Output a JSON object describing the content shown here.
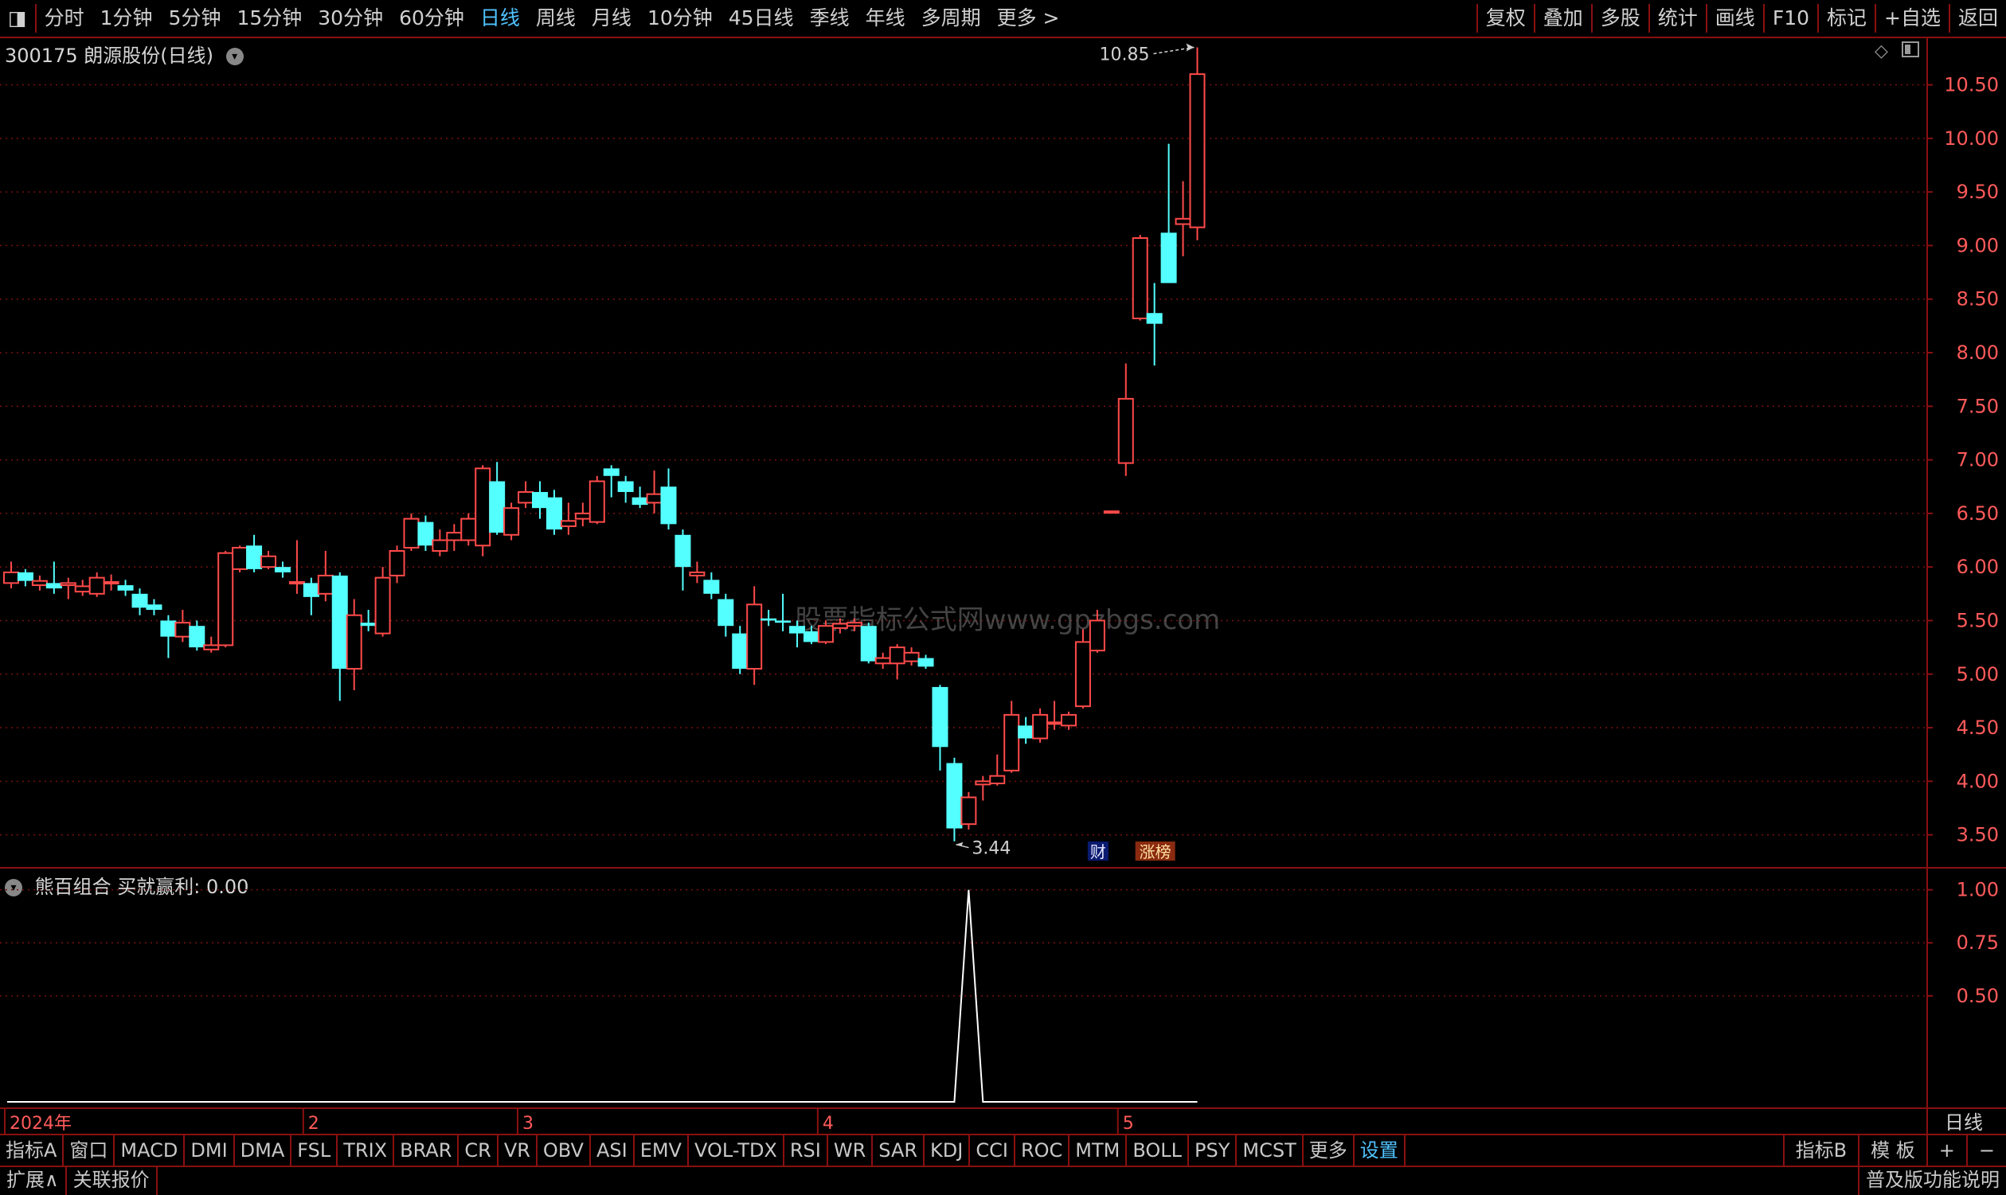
{
  "toolbar": {
    "periods": [
      "分时",
      "1分钟",
      "5分钟",
      "15分钟",
      "30分钟",
      "60分钟",
      "日线",
      "周线",
      "月线",
      "10分钟",
      "45日线",
      "季线",
      "年线",
      "多周期",
      "更多 >"
    ],
    "active_period": "日线",
    "right": [
      "复权",
      "叠加",
      "多股",
      "统计",
      "画线",
      "F10",
      "标记",
      "+自选",
      "返回"
    ]
  },
  "stock": {
    "title": "300175 朗源股份(日线)"
  },
  "indicator": {
    "title": "熊百组合  买就赢利: 0.00"
  },
  "watermark": "股票指标公式网www.gpzbgs.com",
  "badges": {
    "cai": "财",
    "zhang": "涨榜"
  },
  "main_axis": {
    "ticks": [
      "10.50",
      "10.00",
      "9.50",
      "9.00",
      "8.50",
      "8.00",
      "7.50",
      "7.00",
      "6.50",
      "6.00",
      "5.50",
      "5.00",
      "4.50",
      "4.00",
      "3.50"
    ]
  },
  "ind_axis": {
    "ticks": [
      "1.00",
      "0.75",
      "0.50"
    ]
  },
  "date_axis": {
    "labels": [
      "2024年",
      "2",
      "3",
      "4",
      "5"
    ],
    "corner": "日线"
  },
  "bottom_tabs": [
    "指标A",
    "窗口",
    "MACD",
    "DMI",
    "DMA",
    "FSL",
    "TRIX",
    "BRAR",
    "CR",
    "VR",
    "OBV",
    "ASI",
    "EMV",
    "VOL-TDX",
    "RSI",
    "WR",
    "SAR",
    "KDJ",
    "CCI",
    "ROC",
    "MTM",
    "BOLL",
    "PSY",
    "MCST",
    "更多",
    "设置"
  ],
  "bottom_right": [
    "指标B",
    "模 板",
    "+",
    "−"
  ],
  "status_left": [
    "扩展∧",
    "关联报价"
  ],
  "status_right": "普及版功能说明",
  "colors": {
    "up": "#ff4a4a",
    "down": "#54ffff",
    "frame": "#8a1010",
    "grid": "#7a1010",
    "axis_text": "#ff5a5a",
    "active": "#4fc3ff"
  },
  "chart_data": [
    {
      "type": "candlestick",
      "x_label_marks": [
        "2024年",
        "2",
        "3",
        "4",
        "5"
      ],
      "ylim": [
        3.2,
        10.95
      ],
      "max_label": "10.85",
      "min_label": "3.44",
      "candles": [
        [
          5.85,
          5.95,
          6.05,
          5.8
        ],
        [
          5.95,
          5.87,
          5.98,
          5.82
        ],
        [
          5.83,
          5.87,
          5.92,
          5.78
        ],
        [
          5.85,
          5.8,
          6.05,
          5.75
        ],
        [
          5.83,
          5.85,
          5.9,
          5.7
        ],
        [
          5.77,
          5.82,
          5.88,
          5.73
        ],
        [
          5.75,
          5.9,
          5.95,
          5.72
        ],
        [
          5.85,
          5.86,
          5.93,
          5.78
        ],
        [
          5.83,
          5.78,
          5.88,
          5.73
        ],
        [
          5.75,
          5.62,
          5.8,
          5.55
        ],
        [
          5.65,
          5.6,
          5.7,
          5.55
        ],
        [
          5.5,
          5.35,
          5.55,
          5.15
        ],
        [
          5.35,
          5.48,
          5.6,
          5.3
        ],
        [
          5.45,
          5.25,
          5.5,
          5.22
        ],
        [
          5.23,
          5.27,
          5.35,
          5.2
        ],
        [
          5.27,
          6.13,
          6.15,
          5.25
        ],
        [
          5.98,
          6.18,
          6.2,
          5.95
        ],
        [
          6.2,
          5.98,
          6.3,
          5.95
        ],
        [
          6.0,
          6.1,
          6.15,
          5.98
        ],
        [
          6.0,
          5.95,
          6.05,
          5.9
        ],
        [
          5.85,
          5.86,
          6.25,
          5.75
        ],
        [
          5.85,
          5.72,
          5.9,
          5.55
        ],
        [
          5.75,
          5.92,
          6.15,
          5.68
        ],
        [
          5.92,
          5.05,
          5.95,
          4.75
        ],
        [
          5.05,
          5.55,
          5.7,
          4.85
        ],
        [
          5.48,
          5.45,
          5.6,
          5.4
        ],
        [
          5.38,
          5.9,
          6.0,
          5.35
        ],
        [
          5.92,
          6.15,
          6.2,
          5.85
        ],
        [
          6.18,
          6.45,
          6.5,
          6.15
        ],
        [
          6.42,
          6.2,
          6.48,
          6.15
        ],
        [
          6.15,
          6.25,
          6.35,
          6.1
        ],
        [
          6.25,
          6.32,
          6.4,
          6.15
        ],
        [
          6.25,
          6.45,
          6.5,
          6.2
        ],
        [
          6.2,
          6.92,
          6.95,
          6.1
        ],
        [
          6.8,
          6.32,
          6.98,
          6.3
        ],
        [
          6.3,
          6.55,
          6.6,
          6.25
        ],
        [
          6.6,
          6.7,
          6.8,
          6.55
        ],
        [
          6.7,
          6.55,
          6.8,
          6.45
        ],
        [
          6.65,
          6.35,
          6.72,
          6.3
        ],
        [
          6.38,
          6.43,
          6.6,
          6.3
        ],
        [
          6.45,
          6.5,
          6.6,
          6.38
        ],
        [
          6.42,
          6.8,
          6.85,
          6.4
        ],
        [
          6.92,
          6.85,
          6.95,
          6.65
        ],
        [
          6.8,
          6.7,
          6.85,
          6.6
        ],
        [
          6.65,
          6.58,
          6.75,
          6.55
        ],
        [
          6.6,
          6.68,
          6.9,
          6.5
        ],
        [
          6.75,
          6.4,
          6.92,
          6.35
        ],
        [
          6.3,
          6.0,
          6.35,
          5.78
        ],
        [
          5.92,
          5.95,
          6.05,
          5.85
        ],
        [
          5.88,
          5.75,
          5.95,
          5.7
        ],
        [
          5.7,
          5.45,
          5.75,
          5.35
        ],
        [
          5.38,
          5.05,
          5.45,
          5.0
        ],
        [
          5.05,
          5.65,
          5.82,
          4.9
        ],
        [
          5.52,
          5.5,
          5.6,
          5.45
        ],
        [
          5.5,
          5.48,
          5.75,
          5.4
        ],
        [
          5.45,
          5.38,
          5.5,
          5.25
        ],
        [
          5.4,
          5.3,
          5.45,
          5.28
        ],
        [
          5.3,
          5.45,
          5.5,
          5.28
        ],
        [
          5.43,
          5.47,
          5.52,
          5.38
        ],
        [
          5.45,
          5.48,
          5.52,
          5.4
        ],
        [
          5.45,
          5.12,
          5.48,
          5.1
        ],
        [
          5.1,
          5.15,
          5.2,
          5.05
        ],
        [
          5.1,
          5.25,
          5.28,
          4.95
        ],
        [
          5.12,
          5.2,
          5.25,
          5.08
        ],
        [
          5.15,
          5.07,
          5.18,
          5.05
        ],
        [
          4.88,
          4.32,
          4.9,
          4.1
        ],
        [
          4.17,
          3.56,
          4.22,
          3.44
        ],
        [
          3.6,
          3.85,
          3.9,
          3.55
        ],
        [
          3.97,
          4.0,
          4.05,
          3.82
        ],
        [
          3.98,
          4.05,
          4.25,
          3.96
        ],
        [
          4.1,
          4.62,
          4.75,
          4.08
        ],
        [
          4.52,
          4.4,
          4.6,
          4.35
        ],
        [
          4.4,
          4.62,
          4.68,
          4.36
        ],
        [
          4.55,
          4.55,
          4.75,
          4.48
        ],
        [
          4.52,
          4.62,
          4.65,
          4.48
        ],
        [
          4.7,
          5.3,
          5.42,
          4.68
        ],
        [
          5.22,
          5.5,
          5.6,
          5.2
        ],
        [
          6.52,
          6.52,
          6.52,
          6.52
        ],
        [
          6.97,
          7.57,
          7.9,
          6.85
        ],
        [
          8.32,
          9.07,
          9.1,
          8.3
        ],
        [
          8.37,
          8.27,
          8.65,
          7.88
        ],
        [
          9.12,
          8.65,
          9.95,
          8.65
        ],
        [
          9.2,
          9.25,
          9.6,
          8.9
        ],
        [
          9.17,
          10.6,
          10.85,
          9.05
        ]
      ]
    },
    {
      "type": "line",
      "name": "买就赢利",
      "ylim": [
        0,
        1.1
      ],
      "values": [
        0,
        0,
        0,
        0,
        0,
        0,
        0,
        0,
        0,
        0,
        0,
        0,
        0,
        0,
        0,
        0,
        0,
        0,
        0,
        0,
        0,
        0,
        0,
        0,
        0,
        0,
        0,
        0,
        0,
        0,
        0,
        0,
        0,
        0,
        0,
        0,
        0,
        0,
        0,
        0,
        0,
        0,
        0,
        0,
        0,
        0,
        0,
        0,
        0,
        0,
        0,
        0,
        0,
        0,
        0,
        0,
        0,
        0,
        0,
        0,
        0,
        0,
        0,
        0,
        0,
        0,
        0,
        1,
        0,
        0,
        0,
        0,
        0,
        0,
        0,
        0,
        0,
        0,
        0,
        0,
        0,
        0,
        0,
        0
      ]
    }
  ]
}
